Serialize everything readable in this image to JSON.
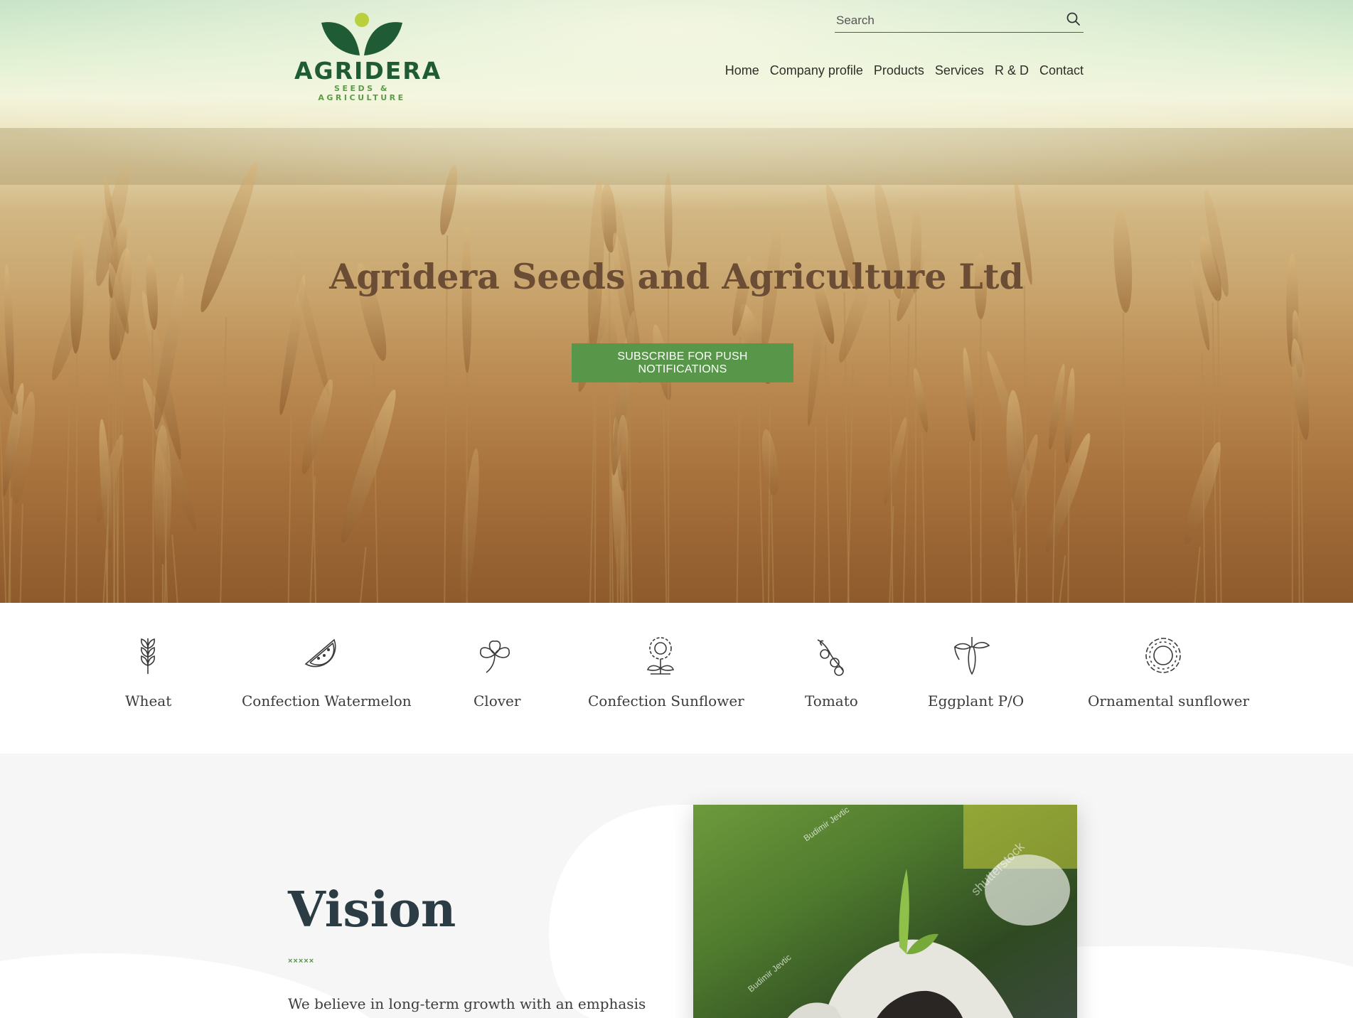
{
  "brand": {
    "name": "AGRIDERA",
    "tagline": "SEEDS & AGRICULTURE"
  },
  "search": {
    "placeholder": "Search"
  },
  "nav": {
    "items": [
      {
        "label": "Home"
      },
      {
        "label": "Company profile"
      },
      {
        "label": "Products"
      },
      {
        "label": "Services"
      },
      {
        "label": "R & D"
      },
      {
        "label": "Contact"
      }
    ]
  },
  "hero": {
    "title": "Agridera Seeds and Agriculture Ltd",
    "cta_label": "SUBSCRIBE FOR PUSH NOTIFICATIONS"
  },
  "categories": [
    {
      "label": "Wheat",
      "icon": "wheat-icon"
    },
    {
      "label": "Confection Watermelon",
      "icon": "watermelon-icon"
    },
    {
      "label": "Clover",
      "icon": "clover-icon"
    },
    {
      "label": "Confection Sunflower",
      "icon": "sunflower-icon"
    },
    {
      "label": "Tomato",
      "icon": "tomato-icon"
    },
    {
      "label": "Eggplant P/O",
      "icon": "eggplant-icon"
    },
    {
      "label": "Ornamental sunflower",
      "icon": "ornamental-sunflower-icon"
    }
  ],
  "vision": {
    "title": "Vision",
    "decoration": "×××××",
    "text": "We believe in long-term growth with an emphasis",
    "image_watermarks": [
      "Budimir Jevtic",
      "shutterstock",
      "Budimir Jevtic"
    ]
  },
  "colors": {
    "brand_green": "#1f5b34",
    "accent_green": "#58974a",
    "hero_title": "#6b4d35",
    "vision_title": "#2b3c44"
  }
}
